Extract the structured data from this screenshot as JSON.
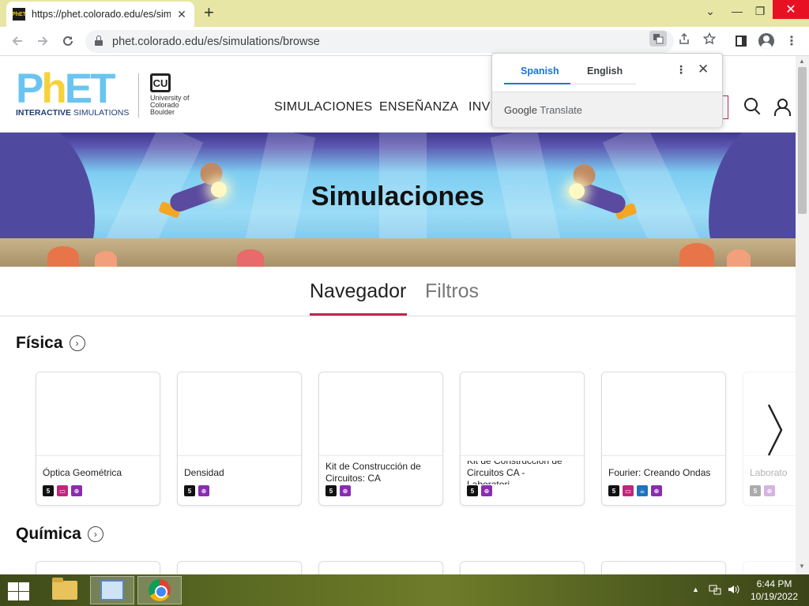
{
  "browser": {
    "tab_title": "https://phet.colorado.edu/es/sim",
    "tab_favicon": "PhET",
    "tab_close": "✕",
    "new_tab": "+",
    "url": "phet.colorado.edu/es/simulations/browse",
    "icons": [
      "back-icon",
      "forward-icon",
      "reload-icon",
      "lock-icon",
      "translate-icon",
      "share-icon",
      "star-icon",
      "side-panel-icon",
      "profile-icon",
      "menu-icon"
    ]
  },
  "window_controls": {
    "dropdown": "⌄",
    "minimize": "—",
    "maximize": "❐",
    "close": "✕"
  },
  "site": {
    "logo_main_left": "P",
    "logo_main_h": "h",
    "logo_main_right": "ET",
    "logo_sub_bold": "INTERACTIVE",
    "logo_sub_regular": " SIMULATIONS",
    "cu_mark": "CU",
    "cu_text": "University of Colorado Boulder",
    "nav": [
      "SIMULACIONES",
      "ENSEÑANZA",
      "INVE"
    ]
  },
  "banner_title": "Simulaciones",
  "view_tabs": {
    "active": "Navegador",
    "inactive": "Filtros"
  },
  "sections": [
    {
      "title": "Física",
      "cards": [
        {
          "title": "Óptica Geométrica",
          "badges": [
            "html5",
            "flash",
            "teacher"
          ]
        },
        {
          "title": "Densidad",
          "badges": [
            "html5",
            "teacher"
          ]
        },
        {
          "title": "Kit de Construcción de Circuitos: CA",
          "badges": [
            "html5",
            "teacher"
          ]
        },
        {
          "title": "Kit de Construcción de Circuitos CA - Laboratori...",
          "badges": [
            "html5",
            "teacher"
          ]
        },
        {
          "title": "Fourier: Creando Ondas",
          "badges": [
            "html5",
            "flash",
            "java",
            "teacher"
          ]
        },
        {
          "title": "Laborato",
          "badges": [
            "html5",
            "teacher"
          ]
        }
      ]
    },
    {
      "title": "Química"
    }
  ],
  "translate_popup": {
    "lang_active": "Spanish",
    "lang_other": "English",
    "more": "⋮",
    "close": "✕",
    "footer_brand": "Google",
    "footer_text": "Translate"
  },
  "taskbar": {
    "time": "6:44 PM",
    "date": "10/19/2022",
    "tray_up": "▲"
  },
  "colors": {
    "accent": "#c0264f",
    "translate_blue": "#1a73e8",
    "tab_strip": "#e8e6a5"
  }
}
